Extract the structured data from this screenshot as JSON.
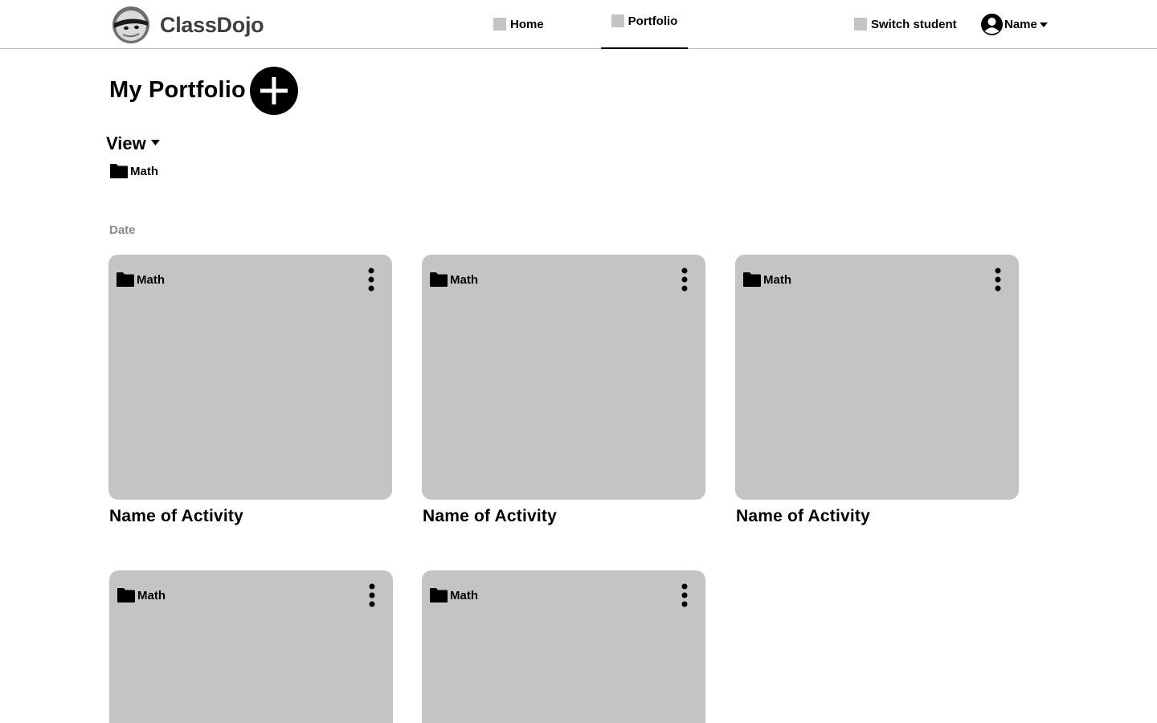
{
  "app": {
    "name": "ClassDojo"
  },
  "nav": {
    "home": "Home",
    "portfolio": "Portfolio",
    "switch_student": "Switch student",
    "user_name": "Name"
  },
  "page": {
    "title": "My Portfolio",
    "view_label": "View",
    "filter_label": "Math",
    "group_label": "Date"
  },
  "icons": {
    "logo": "classdojo-logo-icon",
    "add": "plus-circle-icon",
    "folder": "folder-icon",
    "more": "more-vertical-icon",
    "user": "user-avatar-icon",
    "dropdown": "caret-down-icon"
  },
  "colors": {
    "card_bg": "#c4c4c4",
    "accent": "#000000",
    "muted_text": "#8a8a8a",
    "logo_text": "#3f3f3f"
  },
  "activities": [
    {
      "folder": "Math",
      "title": "Name of Activity"
    },
    {
      "folder": "Math",
      "title": "Name of Activity"
    },
    {
      "folder": "Math",
      "title": "Name of Activity"
    },
    {
      "folder": "Math",
      "title": ""
    },
    {
      "folder": "Math",
      "title": ""
    }
  ]
}
